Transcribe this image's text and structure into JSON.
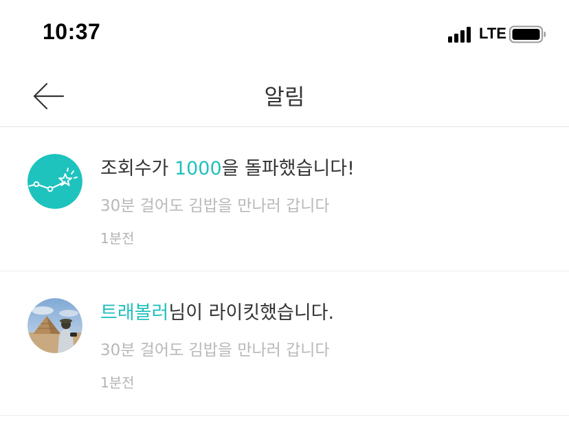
{
  "status_bar": {
    "time": "10:37",
    "network": "LTE",
    "signal_icon": "signal-bars-icon",
    "battery_icon": "battery-full-icon"
  },
  "header": {
    "title": "알림",
    "back_icon": "arrow-left-icon"
  },
  "notifications": [
    {
      "avatar_icon": "rising-chart-star-icon",
      "avatar_color": "#1ec3be",
      "title_pre": "조회수가 ",
      "title_highlight": "1000",
      "title_post": "을 돌파했습니다!",
      "subtitle": "30분 걸어도 김밥을 만나러 갑니다",
      "time": "1분전"
    },
    {
      "avatar_icon": "user-photo-pyramid",
      "title_pre": "",
      "title_highlight": "트래볼러",
      "title_post": "님이 라이킷했습니다.",
      "subtitle": "30분 걸어도 김밥을 만나러 갑니다",
      "time": "1분전"
    }
  ],
  "colors": {
    "accent": "#21c0bd",
    "text_primary": "#333333",
    "text_secondary": "#b8b8b8",
    "divider": "#e3e3e3"
  }
}
